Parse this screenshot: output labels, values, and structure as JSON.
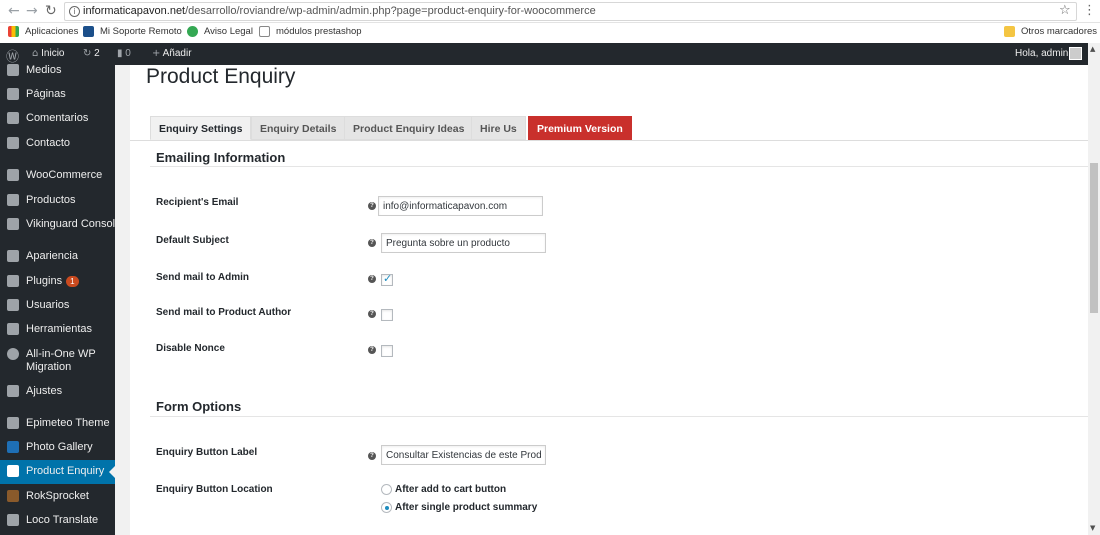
{
  "browser": {
    "url_host": "informaticapavon.net",
    "url_path": "/desarrollo/roviandre/wp-admin/admin.php?page=product-enquiry-for-woocommerce",
    "bookmarks": [
      "Aplicaciones",
      "Mi Soporte Remoto",
      "Aviso Legal",
      "módulos prestashop"
    ],
    "other_bookmarks": "Otros marcadores"
  },
  "adminbar": {
    "home": "Inicio",
    "updates_count": "2",
    "comments_count": "0",
    "add_new": "Añadir",
    "greeting": "Hola, admin"
  },
  "sidebar": {
    "items": [
      {
        "label": "Medios",
        "icon": "media-icon"
      },
      {
        "label": "Páginas",
        "icon": "pages-icon"
      },
      {
        "label": "Comentarios",
        "icon": "comments-icon"
      },
      {
        "label": "Contacto",
        "icon": "mail-icon"
      },
      {
        "label": "WooCommerce",
        "icon": "woocommerce-icon"
      },
      {
        "label": "Productos",
        "icon": "products-icon"
      },
      {
        "label": "Vikinguard Console",
        "icon": "gear-icon"
      },
      {
        "label": "Apariencia",
        "icon": "brush-icon"
      },
      {
        "label": "Plugins",
        "icon": "plugin-icon",
        "badge": "1"
      },
      {
        "label": "Usuarios",
        "icon": "users-icon"
      },
      {
        "label": "Herramientas",
        "icon": "wrench-icon"
      },
      {
        "label": "All-in-One WP",
        "label2": "Migration",
        "icon": "migration-icon"
      },
      {
        "label": "Ajustes",
        "icon": "settings-icon"
      },
      {
        "label": "Epimeteo Theme",
        "icon": "gear-icon"
      },
      {
        "label": "Photo Gallery",
        "icon": "gallery-icon"
      },
      {
        "label": "Product Enquiry",
        "icon": "gear-icon",
        "active": true
      },
      {
        "label": "RokSprocket",
        "icon": "rocket-icon"
      },
      {
        "label": "Loco Translate",
        "icon": "translate-icon"
      }
    ]
  },
  "page": {
    "title": "Product Enquiry",
    "tabs": [
      "Enquiry Settings",
      "Enquiry Details",
      "Product Enquiry Ideas",
      "Hire Us",
      "Premium Version"
    ],
    "sections": {
      "emailing": "Emailing Information",
      "form": "Form Options"
    },
    "fields": {
      "recipient_email": {
        "label": "Recipient's Email",
        "value": "info@informaticapavon.com"
      },
      "default_subject": {
        "label": "Default Subject",
        "value": "Pregunta sobre un producto"
      },
      "send_admin": {
        "label": "Send mail to Admin",
        "checked": true
      },
      "send_author": {
        "label": "Send mail to Product Author",
        "checked": false
      },
      "disable_nonce": {
        "label": "Disable Nonce",
        "checked": false
      },
      "button_label": {
        "label": "Enquiry Button Label",
        "value": "Consultar Existencias de este Producto"
      },
      "button_location": {
        "label": "Enquiry Button Location",
        "options": [
          "After add to cart button",
          "After single product summary"
        ],
        "selected": 1
      }
    }
  },
  "colors": {
    "admin_dark": "#23282d",
    "accent_blue": "#0073aa",
    "premium_red": "#c9302c"
  }
}
